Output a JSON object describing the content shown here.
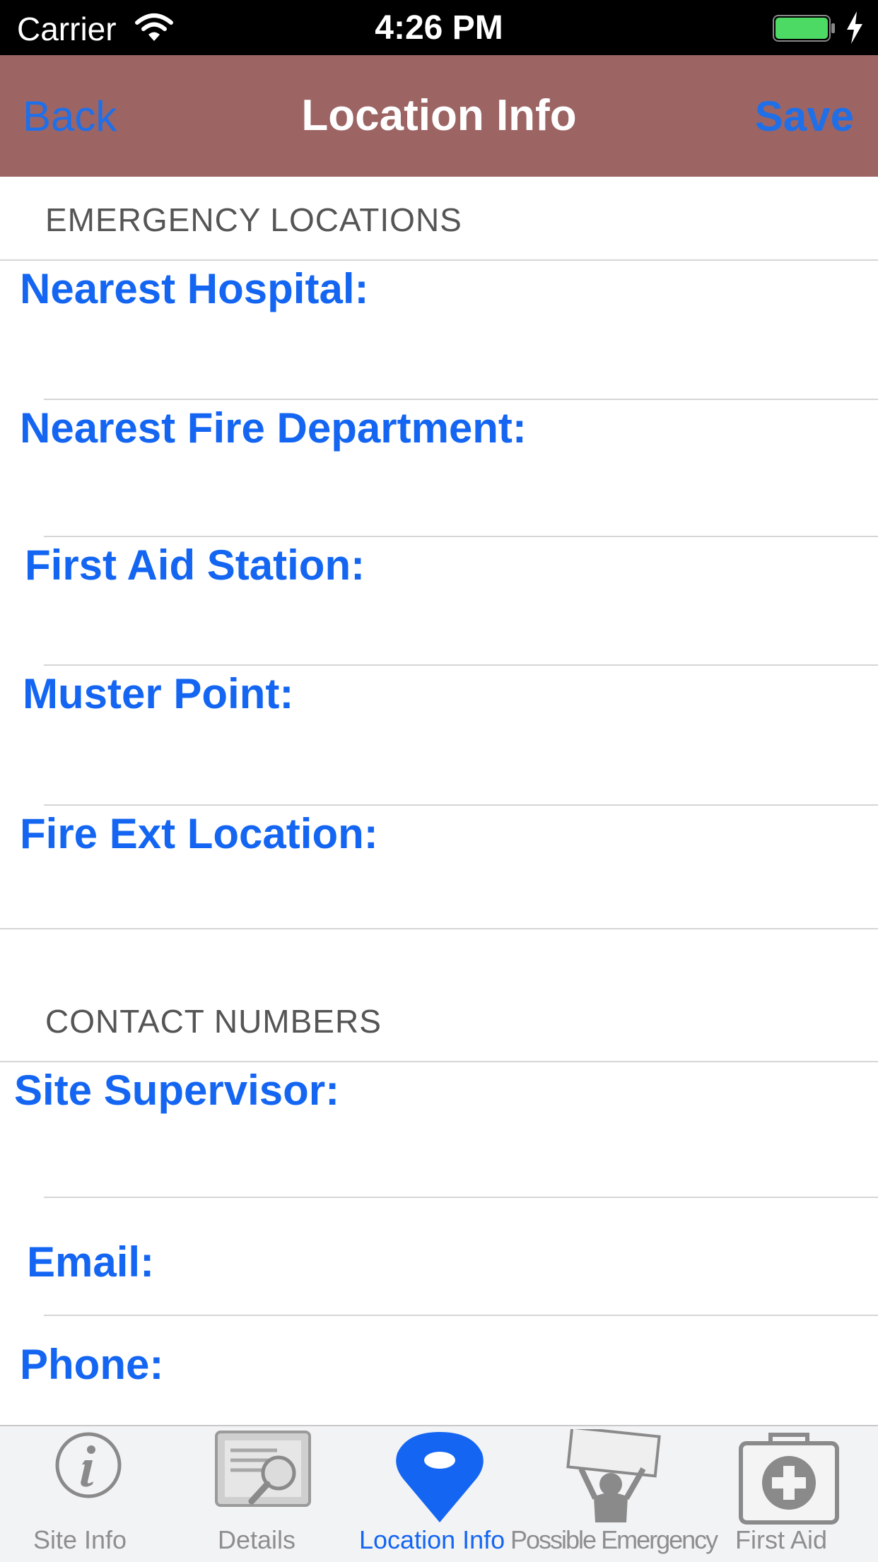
{
  "status_bar": {
    "carrier": "Carrier",
    "time": "4:26 PM"
  },
  "nav": {
    "back": "Back",
    "title": "Location Info",
    "save": "Save"
  },
  "sections": {
    "emergency": {
      "header": "EMERGENCY LOCATIONS",
      "fields": [
        "Nearest Hospital:",
        "Nearest Fire Department:",
        "First Aid Station:",
        "Muster Point:",
        "Fire Ext Location:"
      ]
    },
    "contacts": {
      "header": "CONTACT NUMBERS",
      "fields": [
        "Site Supervisor:",
        "Email:",
        "Phone:"
      ]
    }
  },
  "tabs": [
    {
      "label": "Site Info",
      "icon": "info-icon"
    },
    {
      "label": "Details",
      "icon": "details-magnifier-icon"
    },
    {
      "label": "Location Info",
      "icon": "location-pin-icon",
      "active": true
    },
    {
      "label": "Possible Emergency",
      "icon": "help-sign-person-icon"
    },
    {
      "label": "First Aid",
      "icon": "first-aid-kit-icon"
    }
  ],
  "colors": {
    "nav_bg": "#9c6564",
    "accent": "#1466f2",
    "tint": "#1f6fe8"
  }
}
